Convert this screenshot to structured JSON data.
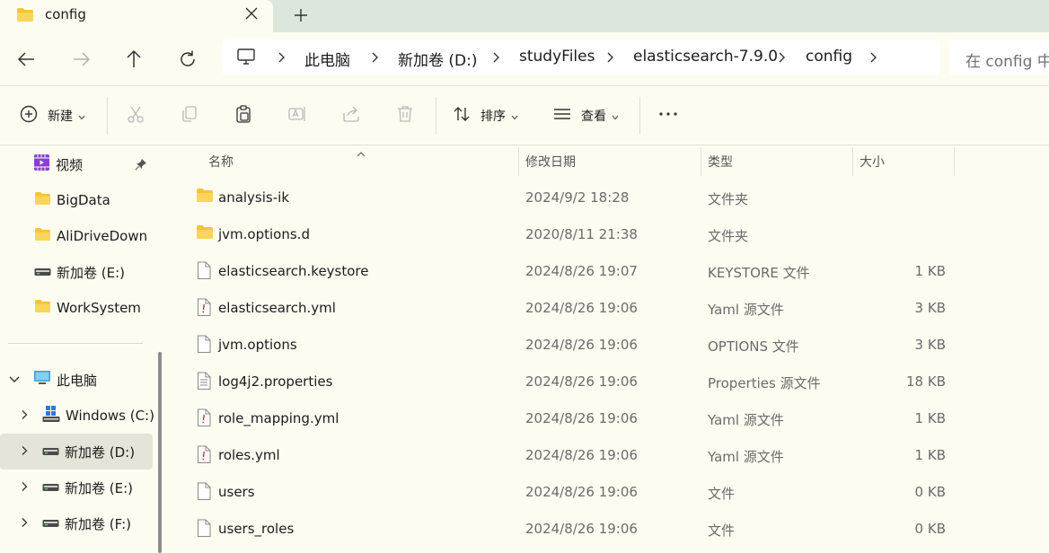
{
  "window": {
    "tab_title": "config",
    "tab_icon": "folder-icon",
    "new_tab": "+"
  },
  "address": {
    "crumbs": [
      "此电脑",
      "新加卷 (D:)",
      "studyFiles",
      "elasticsearch-7.9.0",
      "config"
    ],
    "search_placeholder": "在 config 中搜索"
  },
  "toolbar": {
    "new_label": "新建",
    "sort_label": "排序",
    "view_label": "查看",
    "more_label": "..."
  },
  "sidebar": {
    "items": [
      {
        "label": "视频",
        "icon": "video-folder-icon",
        "pinned": true
      },
      {
        "label": "BigData",
        "icon": "folder-icon"
      },
      {
        "label": "AliDriveDown",
        "icon": "folder-icon"
      },
      {
        "label": "新加卷 (E:)",
        "icon": "drive-icon"
      },
      {
        "label": "WorkSystem",
        "icon": "folder-icon"
      }
    ],
    "tree": [
      {
        "label": "此电脑",
        "icon": "computer-icon",
        "expanded": true
      },
      {
        "label": "Windows (C:)",
        "icon": "windows-drive-icon"
      },
      {
        "label": "新加卷 (D:)",
        "icon": "drive-icon",
        "selected": true
      },
      {
        "label": "新加卷 (E:)",
        "icon": "drive-icon"
      },
      {
        "label": "新加卷 (F:)",
        "icon": "drive-icon"
      }
    ]
  },
  "columns": {
    "name": "名称",
    "date": "修改日期",
    "type": "类型",
    "size": "大小"
  },
  "files": [
    {
      "name": "analysis-ik",
      "date": "2024/9/2 18:28",
      "type": "文件夹",
      "size": "",
      "icon": "folder-icon"
    },
    {
      "name": "jvm.options.d",
      "date": "2020/8/11 21:38",
      "type": "文件夹",
      "size": "",
      "icon": "folder-icon"
    },
    {
      "name": "elasticsearch.keystore",
      "date": "2024/8/26 19:07",
      "type": "KEYSTORE 文件",
      "size": "1 KB",
      "icon": "file-icon"
    },
    {
      "name": "elasticsearch.yml",
      "date": "2024/8/26 19:06",
      "type": "Yaml 源文件",
      "size": "3 KB",
      "icon": "yaml-file-icon"
    },
    {
      "name": "jvm.options",
      "date": "2024/8/26 19:06",
      "type": "OPTIONS 文件",
      "size": "3 KB",
      "icon": "file-icon"
    },
    {
      "name": "log4j2.properties",
      "date": "2024/8/26 19:06",
      "type": "Properties 源文件",
      "size": "18 KB",
      "icon": "properties-file-icon"
    },
    {
      "name": "role_mapping.yml",
      "date": "2024/8/26 19:06",
      "type": "Yaml 源文件",
      "size": "1 KB",
      "icon": "yaml-file-icon"
    },
    {
      "name": "roles.yml",
      "date": "2024/8/26 19:06",
      "type": "Yaml 源文件",
      "size": "1 KB",
      "icon": "yaml-file-icon"
    },
    {
      "name": "users",
      "date": "2024/8/26 19:06",
      "type": "文件",
      "size": "0 KB",
      "icon": "file-icon"
    },
    {
      "name": "users_roles",
      "date": "2024/8/26 19:06",
      "type": "文件",
      "size": "0 KB",
      "icon": "file-icon"
    }
  ],
  "colors": {
    "background": "#fdfcf1",
    "tabbar": "#dde6dc",
    "folder": "#f5c33b",
    "selected": "#e5e4d8"
  }
}
